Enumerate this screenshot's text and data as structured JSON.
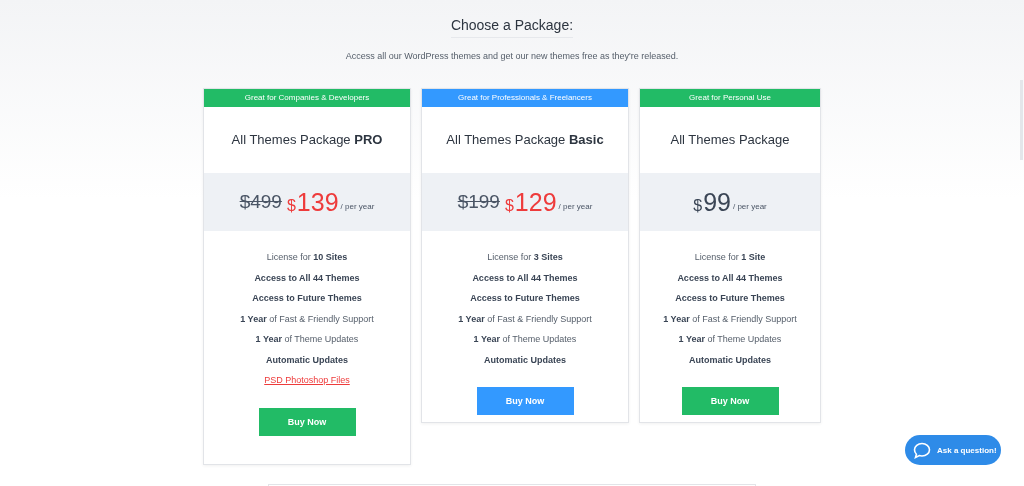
{
  "heading": "Choose a Package:",
  "subheading": "Access all our WordPress themes and get our new themes free as they're released.",
  "packages": [
    {
      "tagline": "Great for Companies & Developers",
      "color": "#22bb66",
      "title": "All Themes Package **PRO**",
      "old_price": "$499",
      "currency": "$",
      "price": "139",
      "sale": true,
      "period": "/ per year",
      "features": [
        {
          "kind": "text",
          "text": "License for **10 Sites**"
        },
        {
          "kind": "text",
          "text": "**Access to All 44 Themes**"
        },
        {
          "kind": "text",
          "text": "**Access to Future Themes**"
        },
        {
          "kind": "text",
          "text": "**1 Year** of Fast & Friendly Support"
        },
        {
          "kind": "text",
          "text": "**1 Year** of Theme Updates"
        },
        {
          "kind": "text",
          "text": "**Automatic Updates**"
        },
        {
          "kind": "link",
          "text": "PSD Photoshop Files"
        }
      ],
      "button": "Buy Now"
    },
    {
      "tagline": "Great for Professionals & Freelancers",
      "color": "#3399ff",
      "title": "All Themes Package **Basic**",
      "old_price": "$199",
      "currency": "$",
      "price": "129",
      "sale": true,
      "period": "/ per year",
      "features": [
        {
          "kind": "text",
          "text": "License for **3 Sites**"
        },
        {
          "kind": "text",
          "text": "**Access to All 44 Themes**"
        },
        {
          "kind": "text",
          "text": "**Access to Future Themes**"
        },
        {
          "kind": "text",
          "text": "**1 Year** of Fast & Friendly Support"
        },
        {
          "kind": "text",
          "text": "**1 Year** of Theme Updates"
        },
        {
          "kind": "text",
          "text": "**Automatic Updates**"
        }
      ],
      "button": "Buy Now"
    },
    {
      "tagline": "Great for Personal Use",
      "color": "#22bb66",
      "title": "All Themes Package",
      "currency": "$",
      "price": "99",
      "sale": false,
      "period": "/ per year",
      "features": [
        {
          "kind": "text",
          "text": "License for **1 Site**"
        },
        {
          "kind": "text",
          "text": "**Access to All 44 Themes**"
        },
        {
          "kind": "text",
          "text": "**Access to Future Themes**"
        },
        {
          "kind": "text",
          "text": "**1 Year** of Fast & Friendly Support"
        },
        {
          "kind": "text",
          "text": "**1 Year** of Theme Updates"
        },
        {
          "kind": "text",
          "text": "**Automatic Updates**"
        }
      ],
      "button": "Buy Now"
    }
  ],
  "chat_button": "Ask a question!"
}
